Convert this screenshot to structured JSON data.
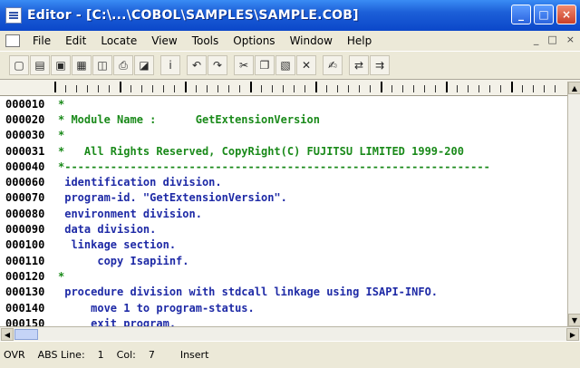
{
  "window": {
    "title": "Editor - [C:\\...\\COBOL\\SAMPLES\\SAMPLE.COB]",
    "controls": [
      "_",
      "□",
      "×"
    ]
  },
  "menu": {
    "items": [
      "File",
      "Edit",
      "Locate",
      "View",
      "Tools",
      "Options",
      "Window",
      "Help"
    ],
    "mdi_controls": [
      "_",
      "□",
      "×"
    ]
  },
  "toolbar": {
    "buttons": [
      "new-icon",
      "open-icon",
      "save-icon",
      "save-all-icon",
      "print-preview-icon",
      "print-icon",
      "properties-icon",
      "info-icon",
      "undo-icon",
      "redo-icon",
      "cut-icon",
      "copy-icon",
      "paste-icon",
      "delete-icon",
      "find-icon",
      "replace-icon",
      "replace-next-icon"
    ],
    "glyphs": [
      "▢",
      "▤",
      "▣",
      "▦",
      "◫",
      "⎙",
      "◪",
      "i",
      "↶",
      "↷",
      "✂",
      "❐",
      "▧",
      "✕",
      "✍",
      "⇄",
      "⇉"
    ]
  },
  "editor": {
    "lines": [
      {
        "num": "000010",
        "text": "*",
        "style": "comment"
      },
      {
        "num": "000020",
        "text": "* Module Name :      GetExtensionVersion",
        "style": "comment"
      },
      {
        "num": "000030",
        "text": "*",
        "style": "comment"
      },
      {
        "num": "000031",
        "text": "*   All Rights Reserved, CopyRight(C) FUJITSU LIMITED 1999-200",
        "style": "comment"
      },
      {
        "num": "000040",
        "text": "*-----------------------------------------------------------------",
        "style": "comment"
      },
      {
        "num": "000060",
        "text": " identification division.",
        "style": "kw"
      },
      {
        "num": "000070",
        "text": " program-id. \"GetExtensionVersion\".",
        "style": "kw"
      },
      {
        "num": "000080",
        "text": " environment division.",
        "style": "kw"
      },
      {
        "num": "000090",
        "text": " data division.",
        "style": "kw"
      },
      {
        "num": "000100",
        "text": "  linkage section.",
        "style": "kw"
      },
      {
        "num": "000110",
        "text": "      copy Isapiinf.",
        "style": "kw"
      },
      {
        "num": "000120",
        "text": "*",
        "style": "comment"
      },
      {
        "num": "000130",
        "text": " procedure division with stdcall linkage using ISAPI-INFO.",
        "style": "kw"
      },
      {
        "num": "000140",
        "text": "     move 1 to program-status.",
        "style": "kw"
      },
      {
        "num": "000150",
        "text": "     exit program.",
        "style": "kw"
      }
    ]
  },
  "status": {
    "mode": "OVR",
    "abs": "ABS",
    "line_label": "Line:",
    "line_value": "1",
    "col_label": "Col:",
    "col_value": "7",
    "insert": "Insert"
  },
  "colors": {
    "comment": "#1a8a1a",
    "keyword": "#1e2aa6",
    "titlebar": "#0b47c9"
  }
}
